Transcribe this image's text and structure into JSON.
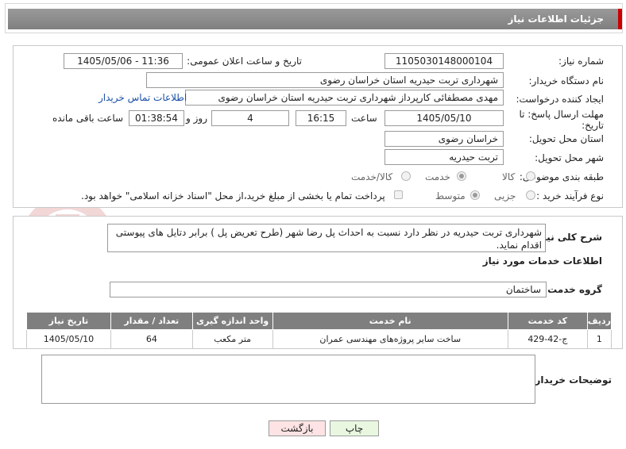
{
  "header": {
    "title": "جزئیات اطلاعات نیاز"
  },
  "form": {
    "need_number_label": "شماره نیاز:",
    "need_number": "1105030148000104",
    "announce_label": "تاریخ و ساعت اعلان عمومی:",
    "announce_value": "1405/05/06 - 11:36",
    "buyer_org_label": "نام دستگاه خریدار:",
    "buyer_org": "شهرداری تربت حیدریه استان خراسان رضوی",
    "creator_label": "ایجاد کننده درخواست:",
    "creator": "مهدی مصطفائی کارپرداز شهرداری تربت حیدریه استان خراسان رضوی",
    "contact_link": "اطلاعات تماس خریدار",
    "deadline_label": "مهلت ارسال پاسخ: تا تاریخ:",
    "deadline_date": "1405/05/10",
    "time_label": "ساعت",
    "deadline_time": "16:15",
    "days_value": "4",
    "days_label": "روز و",
    "remaining_value": "01:38:54",
    "remaining_label": "ساعت باقی مانده",
    "province_label": "استان محل تحویل:",
    "province": "خراسان رضوی",
    "city_label": "شهر محل تحویل:",
    "city": "تربت حیدریه",
    "category_label": "طبقه بندی موضوعی:",
    "category_options": [
      "کالا",
      "خدمت",
      "کالا/خدمت"
    ],
    "category_selected": "خدمت",
    "process_label": "نوع فرآیند خرید :",
    "process_options": [
      "جزیی",
      "متوسط"
    ],
    "process_selected": "متوسط",
    "payment_note": "پرداخت تمام یا بخشی از مبلغ خرید،از محل \"اسناد خزانه اسلامی\" خواهد بود."
  },
  "summary": {
    "label": "شرح کلی نیاز:",
    "text": "شهرداری تربت حیدریه در نظر دارد نسبت به احداث پل رضا شهر (طرح تعریض پل ) برابر دتایل های پیوستی اقدام نماید."
  },
  "services": {
    "section_title": "اطلاعات خدمات مورد نیاز",
    "group_label": "گروه خدمت:",
    "group_value": "ساختمان",
    "columns": [
      "ردیف",
      "کد خدمت",
      "نام خدمت",
      "واحد اندازه گیری",
      "تعداد / مقدار",
      "تاریخ نیاز"
    ],
    "rows": [
      [
        "1",
        "ج-42-429",
        "ساخت سایر پروژه‌های مهندسی عمران",
        "متر مکعب",
        "64",
        "1405/05/10"
      ]
    ]
  },
  "buyer_notes": {
    "label": "توضیحات خریدار:",
    "text": ""
  },
  "buttons": {
    "print": "چاپ",
    "back": "بازگشت"
  },
  "watermark": {
    "text": "AriaTender.neT"
  },
  "colors": {
    "header_bg": "#8c8c8c",
    "accent": "#cc0000",
    "link": "#1a4fa8",
    "print_bg": "#e9f7e0",
    "back_bg": "#fde3e3"
  }
}
